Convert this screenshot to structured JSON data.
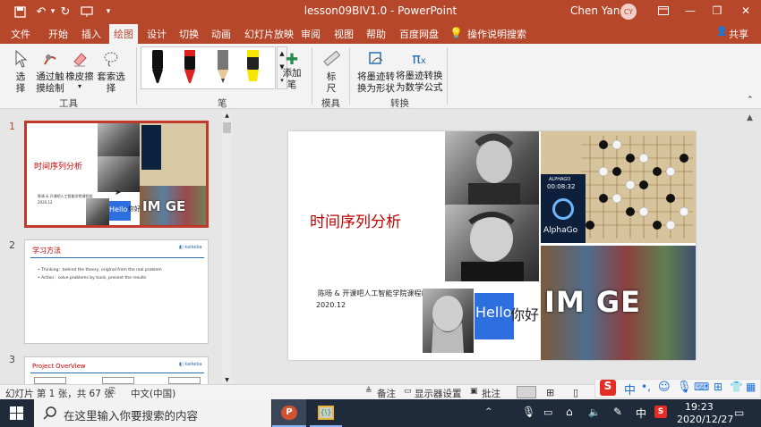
{
  "window": {
    "title": "lesson09BIV1.0  -  PowerPoint",
    "user_name": "Chen Yang",
    "user_initials": "CY"
  },
  "quick_access": {
    "save_icon": "save-icon",
    "undo_icon": "undo-icon",
    "redo_icon": "redo-icon",
    "from_beginning_icon": "start-presentation-icon"
  },
  "ribbon_tabs": [
    {
      "label": "文件"
    },
    {
      "label": "开始"
    },
    {
      "label": "插入"
    },
    {
      "label": "绘图"
    },
    {
      "label": "设计"
    },
    {
      "label": "切换"
    },
    {
      "label": "动画"
    },
    {
      "label": "幻灯片放映"
    },
    {
      "label": "审阅"
    },
    {
      "label": "视图"
    },
    {
      "label": "帮助"
    },
    {
      "label": "百度网盘"
    }
  ],
  "tell_me": "操作说明搜索",
  "share": "共享",
  "ribbon": {
    "tools_group": "工具",
    "select": "选\n择",
    "draw_touch": "通过触\n摸绘制",
    "eraser": "橡皮擦",
    "lasso": "套索选择",
    "pens_group": "笔",
    "add_pen": "添加\n笔",
    "stencils_group": "模具",
    "ruler": "标\n尺",
    "convert_group": "转换",
    "ink_to_shape": "将墨迹转\n换为形状",
    "ink_to_math": "将墨迹转换\n为数学公式"
  },
  "slides": [
    {
      "number": "1",
      "title": "时间序列分析",
      "subtitle": "陈旸 & 开课吧人工智能学院课程组",
      "date": "2020.12"
    },
    {
      "number": "2",
      "title": "学习方法",
      "bullets": [
        "Thinking：behind the theory, original from the real problem",
        "Action：solve problems by tools, present the results"
      ]
    },
    {
      "number": "3",
      "title": "Project OverView"
    }
  ],
  "main_slide": {
    "title": "时间序列分析",
    "subtitle": "陈旸 & 开课吧人工智能学院课程组",
    "date": "2020.12",
    "alphago_label": "ALPHAGO",
    "alphago_time": "00:08:32",
    "alphago_name": "AlphaGo",
    "hello": "Hello",
    "nihao": "你好",
    "image_text": "IM  GE"
  },
  "statusbar": {
    "slide_info": "幻灯片 第 1 张，共 67 张",
    "language": "中文(中国)",
    "notes": "备注",
    "display_settings": "显示器设置",
    "comments": "批注"
  },
  "taskbar": {
    "search_placeholder": "在这里输入你要搜索的内容",
    "time": "19:23",
    "date": "2020/12/27",
    "ime": "中",
    "ime2": "中"
  },
  "colors": {
    "accent": "#b7472a",
    "slide_title": "#c00000"
  }
}
